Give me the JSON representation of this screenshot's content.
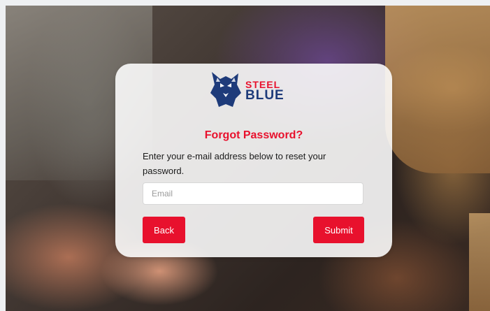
{
  "brand": {
    "logo_line1": "STEEL",
    "logo_line2": "BLUE",
    "primary_color": "#e8112d",
    "secondary_color": "#1e3b7a"
  },
  "form": {
    "title": "Forgot Password?",
    "instructions": "Enter your e-mail address below to reset your password.",
    "email_placeholder": "Email",
    "email_value": "",
    "back_label": "Back",
    "submit_label": "Submit"
  }
}
